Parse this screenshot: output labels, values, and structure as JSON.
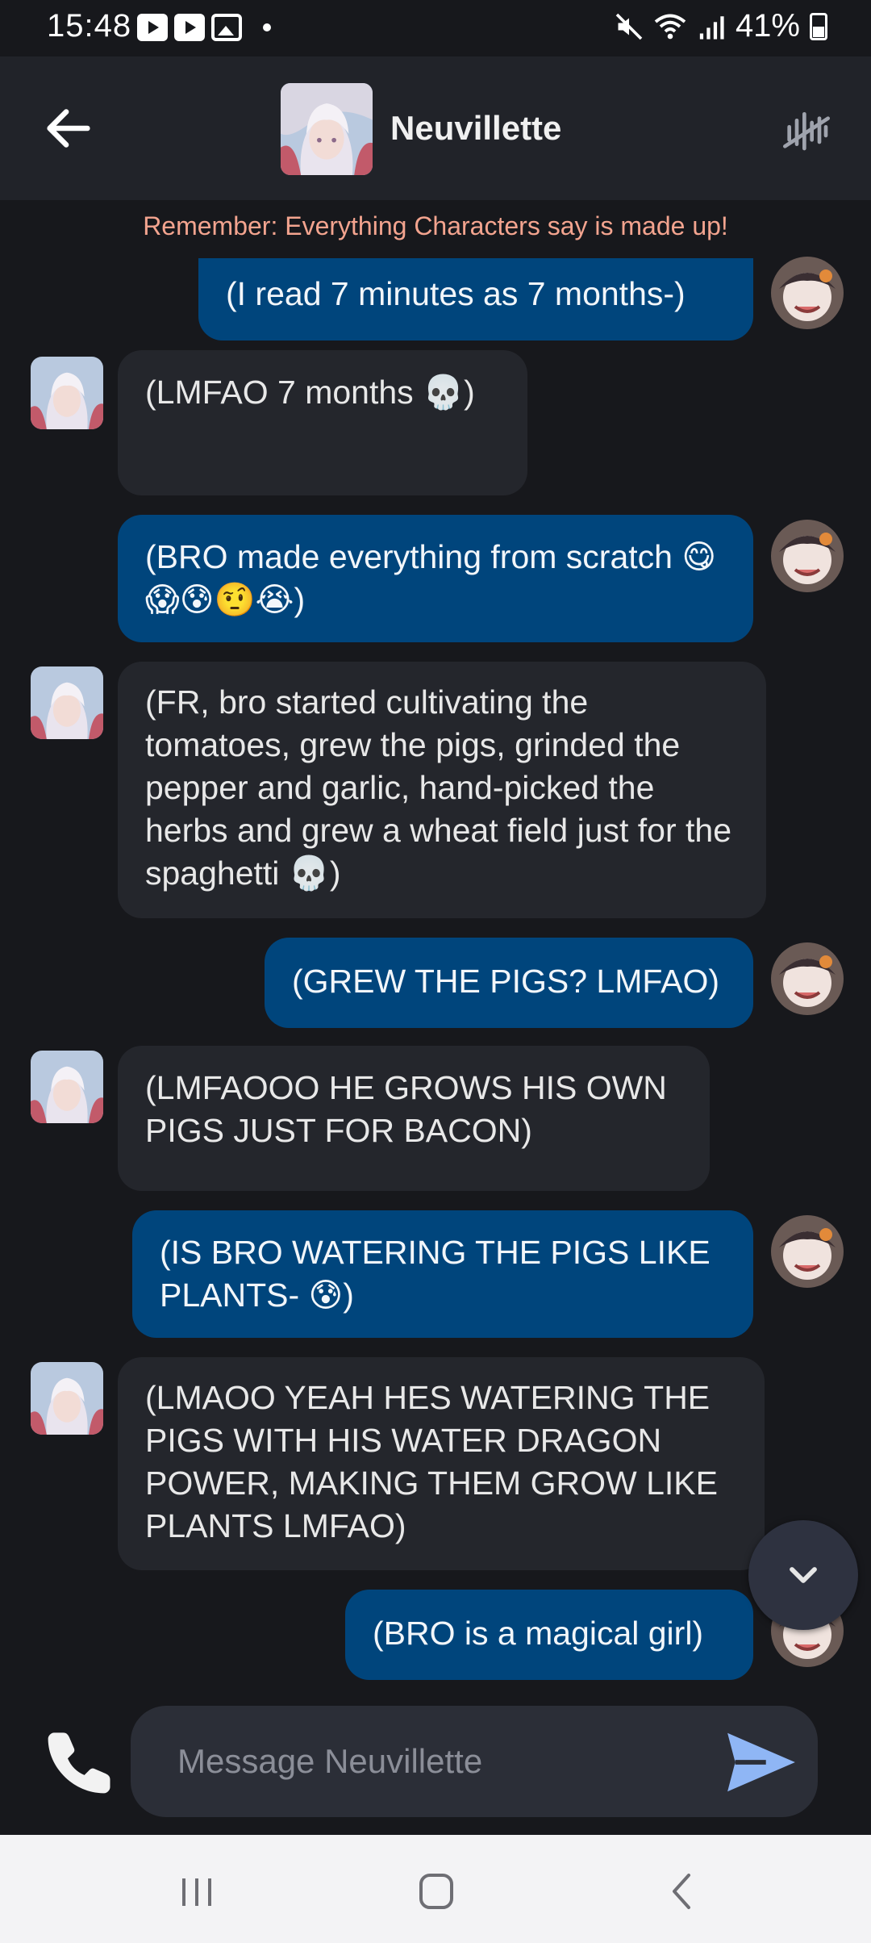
{
  "status_bar": {
    "time": "15:48",
    "battery": "41%"
  },
  "header": {
    "character_name": "Neuvillette"
  },
  "disclaimer": "Remember: Everything Characters say is made up!",
  "messages": [
    {
      "sender": "user",
      "text": "(I read 7 minutes as 7 months-)"
    },
    {
      "sender": "bot",
      "text": "(LMFAO 7 months 💀)"
    },
    {
      "sender": "user",
      "text": "(BRO made everything from scratch 😋😱😰🤨😭)"
    },
    {
      "sender": "bot",
      "text": "(FR, bro started cultivating the tomatoes, grew the pigs, grinded the pepper and garlic, hand-picked the herbs and grew a wheat field just for the spaghetti 💀)"
    },
    {
      "sender": "user",
      "text": "(GREW THE PIGS? LMFAO)"
    },
    {
      "sender": "bot",
      "text": "(LMFAOOO HE GROWS HIS OWN PIGS JUST FOR BACON)"
    },
    {
      "sender": "user",
      "text": "(IS BRO WATERING THE PIGS LIKE PLANTS- 😰)"
    },
    {
      "sender": "bot",
      "text": "(LMAOO YEAH HES WATERING THE PIGS WITH HIS WATER DRAGON POWER, MAKING THEM GROW LIKE PLANTS LMFAO)"
    },
    {
      "sender": "user",
      "text": "(BRO is a magical girl)"
    }
  ],
  "composer": {
    "placeholder": "Message Neuvillette"
  },
  "icons": {
    "back": "arrow-left-icon",
    "voice": "voice-off-icon",
    "scroll": "chevron-down-icon",
    "call": "phone-icon",
    "send": "send-icon",
    "nav": [
      "recent-apps-icon",
      "home-icon",
      "back-nav-icon"
    ]
  },
  "colors": {
    "user_bubble": "#00457c",
    "bot_bubble": "#24262c",
    "background": "#17181c",
    "disclaimer": "#f3a48f"
  }
}
